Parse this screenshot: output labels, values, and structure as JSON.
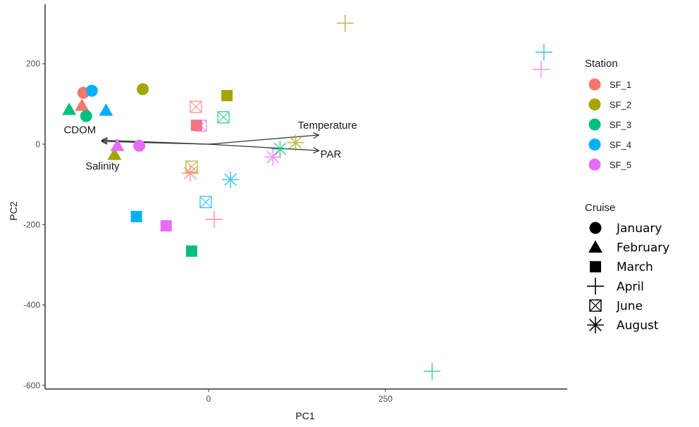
{
  "chart_data": {
    "type": "scatter",
    "title": "",
    "xlabel": "PC1",
    "ylabel": "PC2",
    "xlim": [
      -230,
      510
    ],
    "ylim": [
      -610,
      345
    ],
    "x_ticks": [
      0,
      250
    ],
    "y_ticks": [
      200,
      0,
      -200,
      -400,
      -600
    ],
    "grid": false,
    "legends": [
      {
        "title": "Station",
        "placement": "right-top",
        "entries": [
          {
            "label": "SF_1",
            "color": "#F8766D"
          },
          {
            "label": "SF_2",
            "color": "#A3A500"
          },
          {
            "label": "SF_3",
            "color": "#00BF7D"
          },
          {
            "label": "SF_4",
            "color": "#00B0F6"
          },
          {
            "label": "SF_5",
            "color": "#E76BF3"
          }
        ]
      },
      {
        "title": "Cruise",
        "placement": "right-middle",
        "entries": [
          {
            "label": "January",
            "shape": "circle"
          },
          {
            "label": "February",
            "shape": "triangle"
          },
          {
            "label": "March",
            "shape": "square"
          },
          {
            "label": "April",
            "shape": "plus"
          },
          {
            "label": "June",
            "shape": "boxx"
          },
          {
            "label": "August",
            "shape": "asterisk"
          }
        ]
      }
    ],
    "points": [
      {
        "station": "SF_1",
        "cruise": "January",
        "x": -177,
        "y": 128
      },
      {
        "station": "SF_4",
        "cruise": "January",
        "x": -165,
        "y": 133
      },
      {
        "station": "SF_3",
        "cruise": "February",
        "x": -197,
        "y": 86
      },
      {
        "station": "SF_1",
        "cruise": "February",
        "x": -179,
        "y": 96
      },
      {
        "station": "SF_3",
        "cruise": "January",
        "x": -173,
        "y": 70
      },
      {
        "station": "SF_4",
        "cruise": "February",
        "x": -145,
        "y": 84
      },
      {
        "station": "SF_2",
        "cruise": "January",
        "x": -93,
        "y": 137
      },
      {
        "station": "SF_2",
        "cruise": "February",
        "x": -133,
        "y": -26
      },
      {
        "station": "SF_5",
        "cruise": "February",
        "x": -129,
        "y": -4
      },
      {
        "station": "SF_5",
        "cruise": "January",
        "x": -98,
        "y": -4
      },
      {
        "station": "SF_2",
        "cruise": "March",
        "x": 26,
        "y": 121
      },
      {
        "station": "SF_1",
        "cruise": "June",
        "x": -18,
        "y": 93
      },
      {
        "station": "SF_3",
        "cruise": "June",
        "x": 21,
        "y": 67
      },
      {
        "station": "SF_1",
        "cruise": "March",
        "x": -17,
        "y": 47
      },
      {
        "station": "SF_5",
        "cruise": "June",
        "x": -11,
        "y": 46
      },
      {
        "station": "SF_2",
        "cruise": "June",
        "x": -24,
        "y": -56
      },
      {
        "station": "SF_1",
        "cruise": "August",
        "x": -26,
        "y": -72
      },
      {
        "station": "SF_4",
        "cruise": "August",
        "x": 31,
        "y": -88
      },
      {
        "station": "SF_4",
        "cruise": "June",
        "x": -4,
        "y": -144
      },
      {
        "station": "SF_1",
        "cruise": "April",
        "x": 8,
        "y": -187
      },
      {
        "station": "SF_4",
        "cruise": "March",
        "x": -102,
        "y": -180
      },
      {
        "station": "SF_5",
        "cruise": "March",
        "x": -60,
        "y": -203
      },
      {
        "station": "SF_3",
        "cruise": "March",
        "x": -24,
        "y": -266
      },
      {
        "station": "SF_2",
        "cruise": "August",
        "x": 123,
        "y": 4
      },
      {
        "station": "SF_3",
        "cruise": "August",
        "x": 101,
        "y": -12
      },
      {
        "station": "SF_5",
        "cruise": "August",
        "x": 91,
        "y": -32
      },
      {
        "station": "SF_2",
        "cruise": "April",
        "x": 193,
        "y": 301
      },
      {
        "station": "SF_4",
        "cruise": "April",
        "x": 474,
        "y": 229
      },
      {
        "station": "SF_5",
        "cruise": "April",
        "x": 470,
        "y": 186
      },
      {
        "station": "SF_3",
        "cruise": "April",
        "x": 316,
        "y": -565
      }
    ],
    "vectors": [
      {
        "label": "CDOM",
        "x": -151,
        "y": 10
      },
      {
        "label": "Salinity",
        "x": -151,
        "y": 7
      },
      {
        "label": "Temperature",
        "x": 156,
        "y": 23
      },
      {
        "label": "PAR",
        "x": 156,
        "y": -16
      }
    ]
  }
}
